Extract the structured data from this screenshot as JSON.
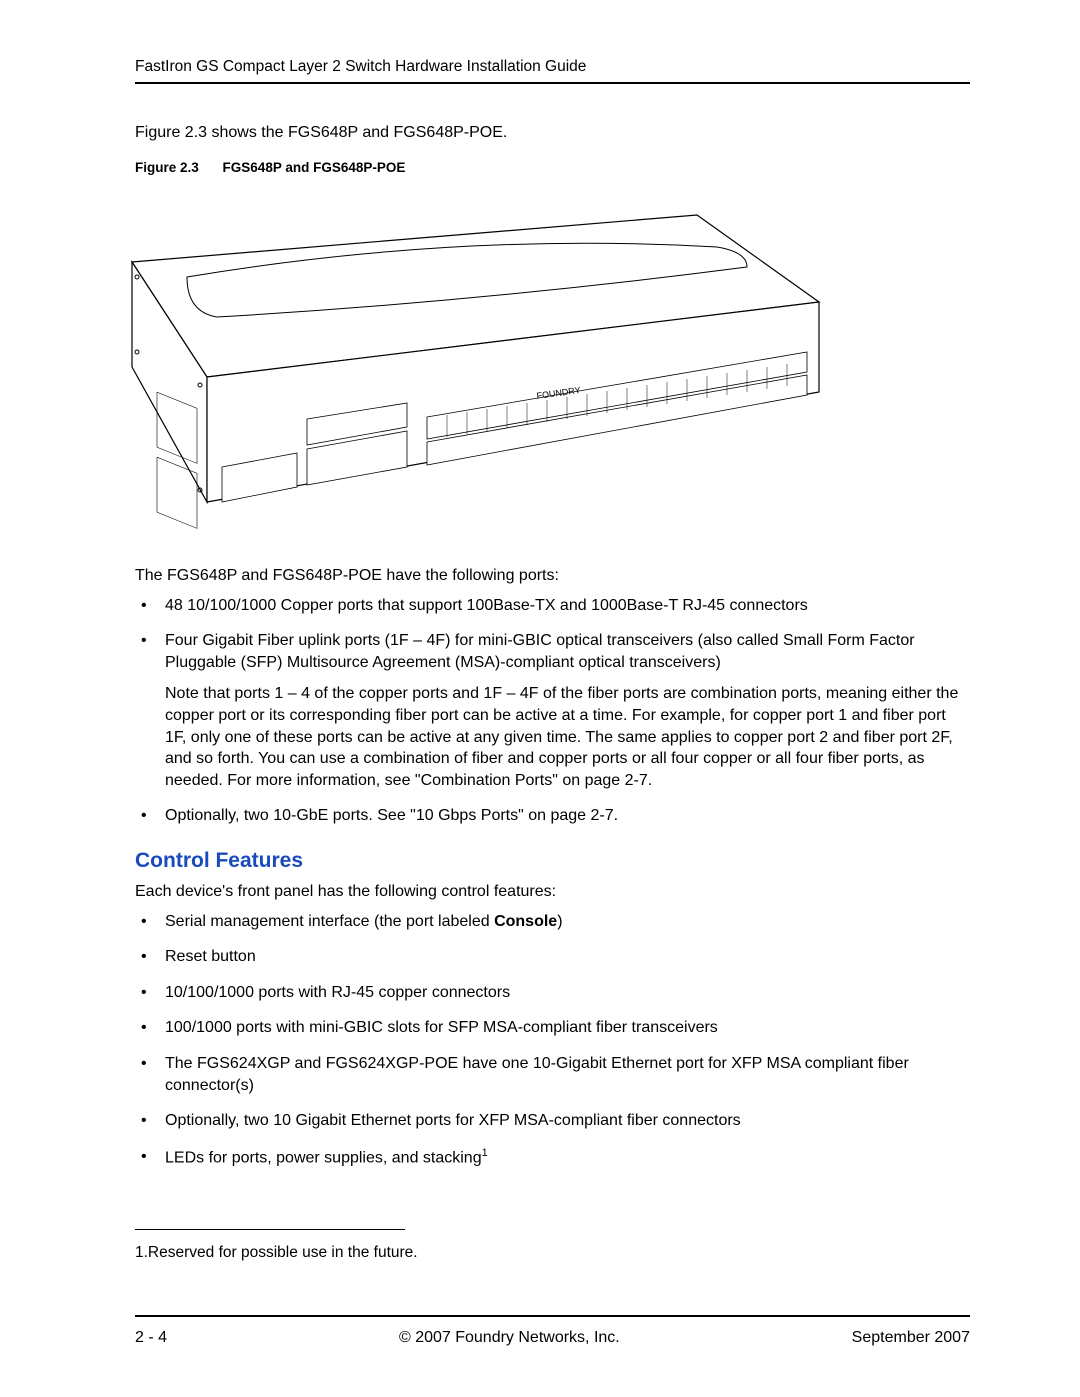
{
  "header": {
    "title": "FastIron GS Compact Layer 2 Switch Hardware Installation Guide"
  },
  "intro": "Figure 2.3 shows the FGS648P and FGS648P-POE.",
  "figure": {
    "number": "Figure 2.3",
    "title": "FGS648P and FGS648P-POE"
  },
  "ports_intro": "The FGS648P and FGS648P-POE have the following ports:",
  "ports_list": [
    {
      "text": "48 10/100/1000 Copper ports that support 100Base-TX and 1000Base-T RJ-45 connectors"
    },
    {
      "text": "Four Gigabit Fiber uplink ports (1F – 4F) for mini-GBIC optical transceivers (also called Small Form Factor Pluggable (SFP) Multisource Agreement (MSA)-compliant optical transceivers)",
      "note": "Note that ports 1 – 4 of the copper ports and 1F – 4F of the fiber ports are combination ports, meaning either the copper port or its corresponding fiber port can be active at a time.  For example, for copper port 1 and fiber port 1F, only one of these ports can be active at any given time.  The same applies to copper port 2 and fiber port 2F, and so forth.  You can use a combination of fiber and copper ports or all four copper or all four fiber ports, as needed.  For more information, see \"Combination Ports\" on page 2-7."
    },
    {
      "text": "Optionally, two 10-GbE ports.  See \"10 Gbps Ports\" on page 2-7."
    }
  ],
  "section_heading": "Control Features",
  "control_intro": "Each device's front panel has the following control features:",
  "control_list": [
    "Serial management interface (the port labeled ",
    "Reset button",
    "10/100/1000 ports with RJ-45 copper connectors",
    "100/1000 ports with mini-GBIC slots for SFP MSA-compliant fiber transceivers",
    "The FGS624XGP and FGS624XGP-POE have one 10-Gigabit Ethernet port for XFP MSA compliant fiber connector(s)",
    "Optionally, two 10 Gigabit Ethernet ports for XFP MSA-compliant fiber connectors",
    "LEDs for ports, power supplies, and stacking"
  ],
  "console_bold": "Console",
  "console_close": ")",
  "footnote_marker": "1",
  "footnote_text": "1.Reserved for possible use in the future.",
  "footer": {
    "left": "2 - 4",
    "center": "© 2007 Foundry Networks, Inc.",
    "right": "September 2007"
  }
}
